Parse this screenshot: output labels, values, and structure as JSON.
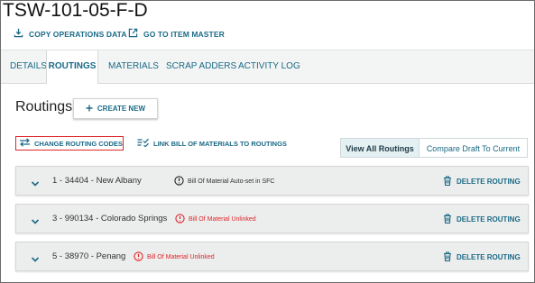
{
  "item_title": "TSW-101-05-F-D",
  "top_actions": {
    "copy_operations": "COPY OPERATIONS DATA",
    "item_master": "GO TO ITEM MASTER"
  },
  "tabs": [
    {
      "label": "DETAILS",
      "active": false
    },
    {
      "label": "ROUTINGS",
      "active": true
    },
    {
      "label": "MATERIALS",
      "active": false
    },
    {
      "label": "SCRAP ADDERS",
      "active": false
    },
    {
      "label": "ACTIVITY LOG",
      "active": false
    }
  ],
  "routings": {
    "title": "Routings",
    "create_label": "CREATE NEW",
    "change_codes_label": "CHANGE ROUTING CODES",
    "link_bom_label": "LINK BILL OF MATERIALS TO ROUTINGS",
    "view_all_label": "View All Routings",
    "compare_label": "Compare Draft To Current",
    "delete_label": "DELETE ROUTING",
    "rows": [
      {
        "label": "1 - 34404 - New Albany",
        "status": "Bill Of Material Auto-set in SFC",
        "status_type": "info"
      },
      {
        "label": "3 - 990134 - Colorado Springs",
        "status": "Bill Of Material Unlinked",
        "status_type": "warning"
      },
      {
        "label": "5 - 38970 - Penang",
        "status": "Bill Of Material Unlinked",
        "status_type": "warning"
      }
    ]
  },
  "colors": {
    "accent": "#1a6a86",
    "warning": "#e0262a",
    "row_bg": "#eceded",
    "active_segment_bg": "#e4f0f2"
  },
  "icons": {
    "copy": "download-icon",
    "item_master": "external-link-icon",
    "create": "plus-icon",
    "change_codes": "swap-arrows-icon",
    "link_bom": "checklist-icon",
    "row_expand": "chevron-down-icon",
    "info": "info-circle-icon",
    "warning": "alert-circle-icon",
    "delete": "trash-icon"
  }
}
